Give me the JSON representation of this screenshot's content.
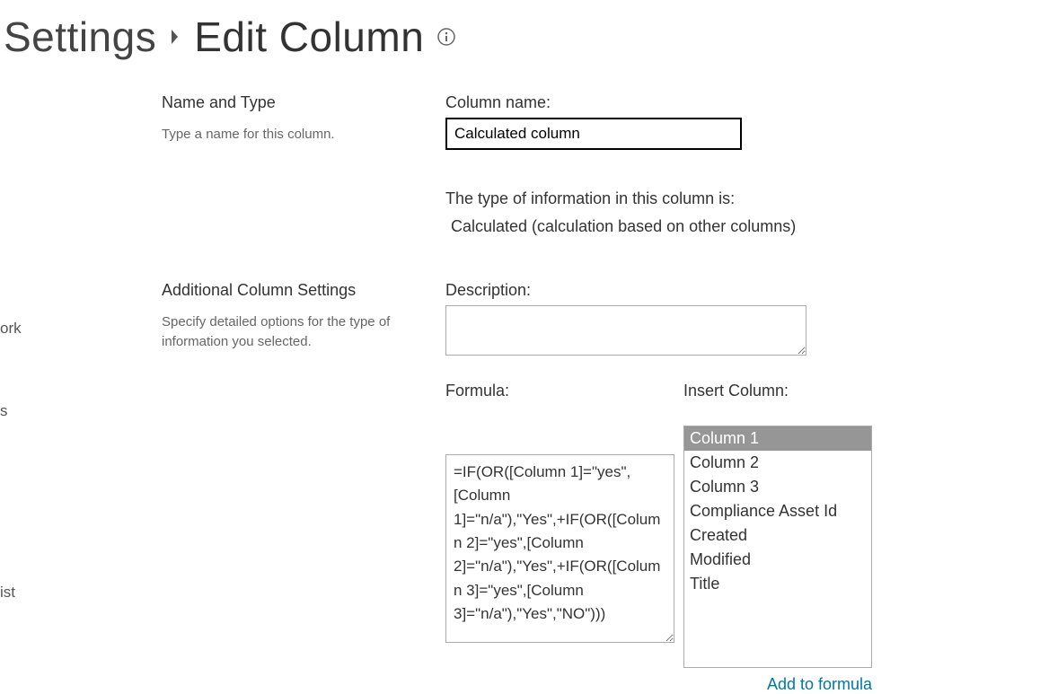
{
  "breadcrumb": {
    "settings": "Settings",
    "page": "Edit Column",
    "info_icon": "info-icon"
  },
  "left_nav_fragments": {
    "one": "ork",
    "two": "s",
    "three": "ist"
  },
  "sections": {
    "name_type": {
      "title": "Name and Type",
      "help": "Type a name for this column.",
      "column_name_label": "Column name:",
      "column_name_value": "Calculated column",
      "type_lead": "The type of information in this column is:",
      "type_value": "Calculated (calculation based on other columns)"
    },
    "additional": {
      "title": "Additional Column Settings",
      "help": "Specify detailed options for the type of information you selected.",
      "description_label": "Description:",
      "description_value": "",
      "formula_label": "Formula:",
      "formula_value": "=IF(OR([Column 1]=\"yes\",[Column 1]=\"n/a\"),\"Yes\",+IF(OR([Column 2]=\"yes\",[Column 2]=\"n/a\"),\"Yes\",+IF(OR([Column 3]=\"yes\",[Column 3]=\"n/a\"),\"Yes\",\"NO\")))",
      "insert_label": "Insert Column:",
      "insert_options": [
        "Column 1",
        "Column 2",
        "Column 3",
        "Compliance Asset Id",
        "Created",
        "Modified",
        "Title"
      ],
      "insert_selected": "Column 1",
      "add_link": "Add to formula"
    }
  }
}
